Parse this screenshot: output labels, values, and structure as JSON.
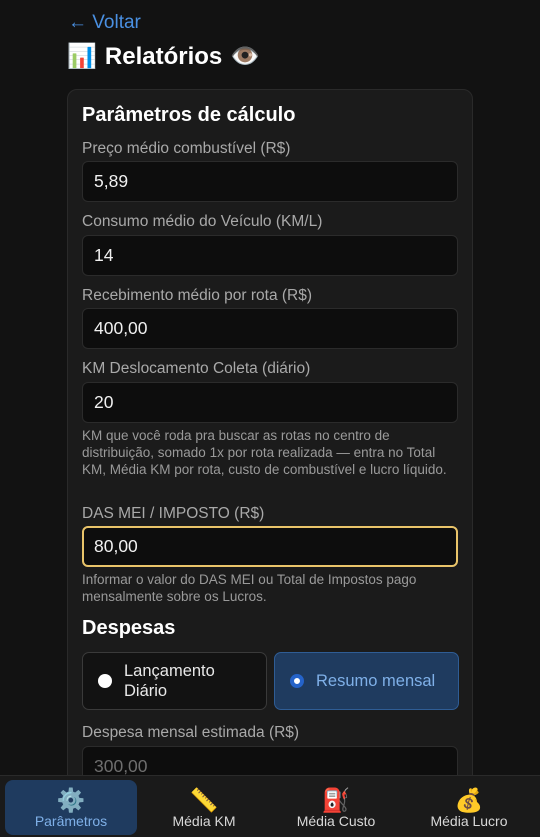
{
  "header": {
    "back_label": "← Voltar",
    "title": "Relatórios",
    "title_icon": "📊",
    "eye_icon": "👁️"
  },
  "params": {
    "title": "Parâmetros de cálculo",
    "fuel_price_label": "Preço médio combustível (R$)",
    "fuel_price_value": "5,89",
    "consumption_label": "Consumo médio do Veículo (KM/L)",
    "consumption_value": "14",
    "income_label": "Recebimento médio por rota (R$)",
    "income_value": "400,00",
    "km_collect_label": "KM Deslocamento Coleta (diário)",
    "km_collect_value": "20",
    "km_collect_help": "KM que você roda pra buscar as rotas no centro de distribuição, somado 1x por rota realizada — entra no Total KM, Média KM por rota, custo de combustível e lucro líquido.",
    "das_label": "DAS MEI / IMPOSTO (R$)",
    "das_value": "80,00",
    "das_help": "Informar o valor do DAS MEI ou Total de Impostos pago mensalmente sobre os Lucros."
  },
  "expenses": {
    "title": "Despesas",
    "option_daily": "Lançamento Diário",
    "option_monthly": "Resumo mensal",
    "monthly_estimate_label": "Despesa mensal estimada (R$)",
    "monthly_estimate_placeholder": "300,00"
  },
  "nav": {
    "items": [
      {
        "label": "Parâmetros",
        "icon": "⚙️"
      },
      {
        "label": "Média KM",
        "icon": "📏"
      },
      {
        "label": "Média Custo",
        "icon": "⛽"
      },
      {
        "label": "Média Lucro",
        "icon": "💰"
      }
    ]
  },
  "colors": {
    "accent": "#4a90e2",
    "focus_border": "#e9c46a",
    "active_bg": "#1f3b5f"
  }
}
